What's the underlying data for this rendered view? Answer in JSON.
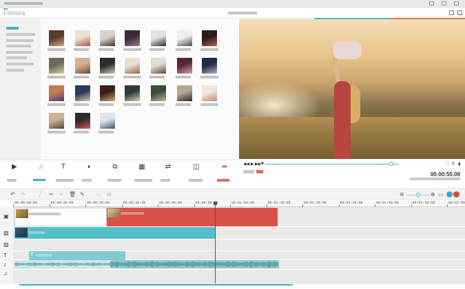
{
  "app": {
    "logo_text": "Filmora",
    "accent_teal": "#3fb3bf",
    "accent_red": "#d9524a"
  },
  "preview": {
    "timecode": "00:00:55.09",
    "progress": 0.93,
    "buttons": [
      "prev-frame-icon",
      "play-icon",
      "next-frame-icon",
      "stop-icon"
    ]
  },
  "edit_toolbar": {
    "items": [
      {
        "name": "media",
        "glyph": "▶",
        "selected": false
      },
      {
        "name": "audio",
        "glyph": "♫",
        "selected": true
      },
      {
        "name": "text",
        "glyph": "T",
        "selected": false
      },
      {
        "name": "filters",
        "glyph": "◐",
        "selected": false
      },
      {
        "name": "overlays",
        "glyph": "⧉",
        "selected": false
      },
      {
        "name": "elements",
        "glyph": "▦",
        "selected": false
      },
      {
        "name": "transitions",
        "glyph": "⇄",
        "selected": false
      },
      {
        "name": "split-screen",
        "glyph": "◫",
        "selected": false
      },
      {
        "name": "export",
        "glyph": "➦",
        "selected": false
      }
    ]
  },
  "timeline": {
    "ruler": [
      "00:00:00:00",
      "00:00:10:00",
      "00:00:20:00",
      "00:00:30:00",
      "00:00:40:00",
      "00:00:50:00",
      "00:01:00:00",
      "00:01:10:00",
      "00:01:20:00",
      "00:01:30:00",
      "00:01:40:00",
      "00:01:50:00",
      "00:02:00:00"
    ],
    "text_clip_label": "T",
    "track_icons": [
      "video-track-icon",
      "image-track-icon",
      "image-track-icon",
      "text-track-icon",
      "music-track-icon",
      "music-track-icon"
    ]
  }
}
